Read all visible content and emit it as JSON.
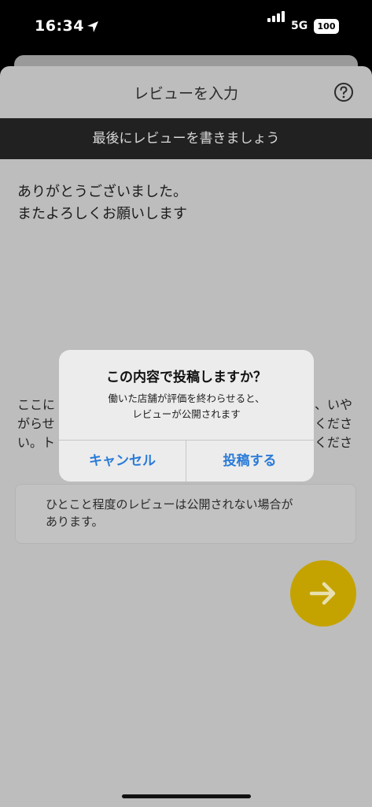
{
  "status_bar": {
    "time": "16:34",
    "network": "5G",
    "battery": "100"
  },
  "header": {
    "title": "レビューを入力"
  },
  "banner": {
    "text": "最後にレビューを書きましょう"
  },
  "review": {
    "text": "ありがとうございました。\nまたよろしくお願いします"
  },
  "hint": {
    "left": "ここに\nがらせ\nい。ト",
    "right": "、いや\nくださ\nくださ"
  },
  "notice": {
    "text": "ひとこと程度のレビューは公開されない場合が\nあります。"
  },
  "dialog": {
    "title": "この内容で投稿しますか？",
    "message": "働いた店舗が評価を終わらせると、\nレビューが公開されます",
    "cancel_label": "キャンセル",
    "submit_label": "投稿する"
  },
  "colors": {
    "accent_button": "#c4a300",
    "dialog_link": "#2a7bd8",
    "banner_bg": "#212121"
  },
  "icons": {
    "location": "location-arrow-icon",
    "help": "question-circle-icon",
    "next": "arrow-right-icon"
  }
}
